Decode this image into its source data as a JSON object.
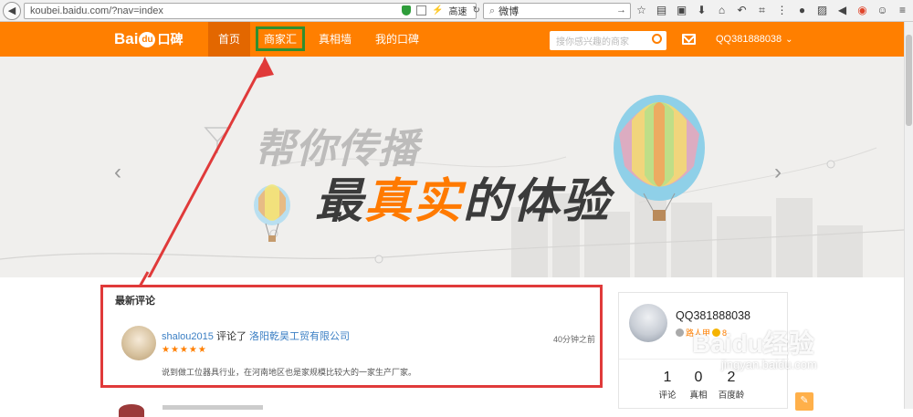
{
  "browser": {
    "url": "koubei.baidu.com/?nav=index",
    "speed_label": "高速",
    "search_value": "微博"
  },
  "header": {
    "logo_bai": "Bai",
    "logo_du": "du",
    "logo_kb": "口碑",
    "nav": [
      {
        "label": "首页"
      },
      {
        "label": "商家汇"
      },
      {
        "label": "真相墙"
      },
      {
        "label": "我的口碑"
      }
    ],
    "search_placeholder": "搜你感兴趣的商家",
    "user_name": "QQ381888038"
  },
  "banner": {
    "slogan_line1": "帮你传播",
    "slogan_line2_a": "最",
    "slogan_line2_b": "真实",
    "slogan_line2_c": "的体验"
  },
  "reviews": {
    "title": "最新评论",
    "items": [
      {
        "user": "shalou2015",
        "verb": " 评论了 ",
        "company": "洛阳乾昊工贸有限公司",
        "rating": 5,
        "stars": "★★★★★",
        "time": "40分钟之前",
        "text": "说到做工位器具行业，在河南地区也是家规模比较大的一家生产厂家。"
      }
    ]
  },
  "profile": {
    "name": "QQ381888038",
    "level": "路人甲",
    "coins": "8",
    "stats": [
      {
        "value": "1",
        "label": "评论"
      },
      {
        "value": "0",
        "label": "真相"
      },
      {
        "value": "2",
        "label": "百度龄"
      }
    ]
  },
  "watermark": {
    "brand": "Baidu经验",
    "url": "jingyan.baidu.com"
  },
  "colors": {
    "accent": "#ff7f00",
    "annotation_red": "#e03a3a",
    "annotation_green": "#2f8f2f",
    "link_blue": "#3b7fc4"
  }
}
